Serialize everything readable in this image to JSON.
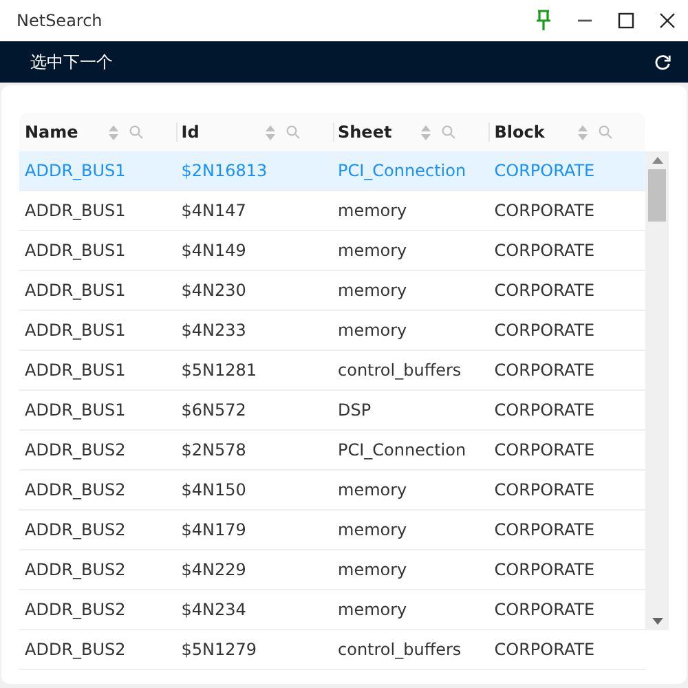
{
  "window": {
    "title": "NetSearch"
  },
  "toolbar": {
    "action": "选中下一个"
  },
  "table": {
    "columns": [
      "Name",
      "Id",
      "Sheet",
      "Block"
    ],
    "rows": [
      {
        "cells": [
          "ADDR_BUS1",
          "$2N16813",
          "PCI_Connection",
          "CORPORATE"
        ],
        "selected": true
      },
      {
        "cells": [
          "ADDR_BUS1",
          "$4N147",
          "memory",
          "CORPORATE"
        ],
        "selected": false
      },
      {
        "cells": [
          "ADDR_BUS1",
          "$4N149",
          "memory",
          "CORPORATE"
        ],
        "selected": false
      },
      {
        "cells": [
          "ADDR_BUS1",
          "$4N230",
          "memory",
          "CORPORATE"
        ],
        "selected": false
      },
      {
        "cells": [
          "ADDR_BUS1",
          "$4N233",
          "memory",
          "CORPORATE"
        ],
        "selected": false
      },
      {
        "cells": [
          "ADDR_BUS1",
          "$5N1281",
          "control_buffers",
          "CORPORATE"
        ],
        "selected": false
      },
      {
        "cells": [
          "ADDR_BUS1",
          "$6N572",
          "DSP",
          "CORPORATE"
        ],
        "selected": false
      },
      {
        "cells": [
          "ADDR_BUS2",
          "$2N578",
          "PCI_Connection",
          "CORPORATE"
        ],
        "selected": false
      },
      {
        "cells": [
          "ADDR_BUS2",
          "$4N150",
          "memory",
          "CORPORATE"
        ],
        "selected": false
      },
      {
        "cells": [
          "ADDR_BUS2",
          "$4N179",
          "memory",
          "CORPORATE"
        ],
        "selected": false
      },
      {
        "cells": [
          "ADDR_BUS2",
          "$4N229",
          "memory",
          "CORPORATE"
        ],
        "selected": false
      },
      {
        "cells": [
          "ADDR_BUS2",
          "$4N234",
          "memory",
          "CORPORATE"
        ],
        "selected": false
      },
      {
        "cells": [
          "ADDR_BUS2",
          "$5N1279",
          "control_buffers",
          "CORPORATE"
        ],
        "selected": false
      }
    ]
  }
}
